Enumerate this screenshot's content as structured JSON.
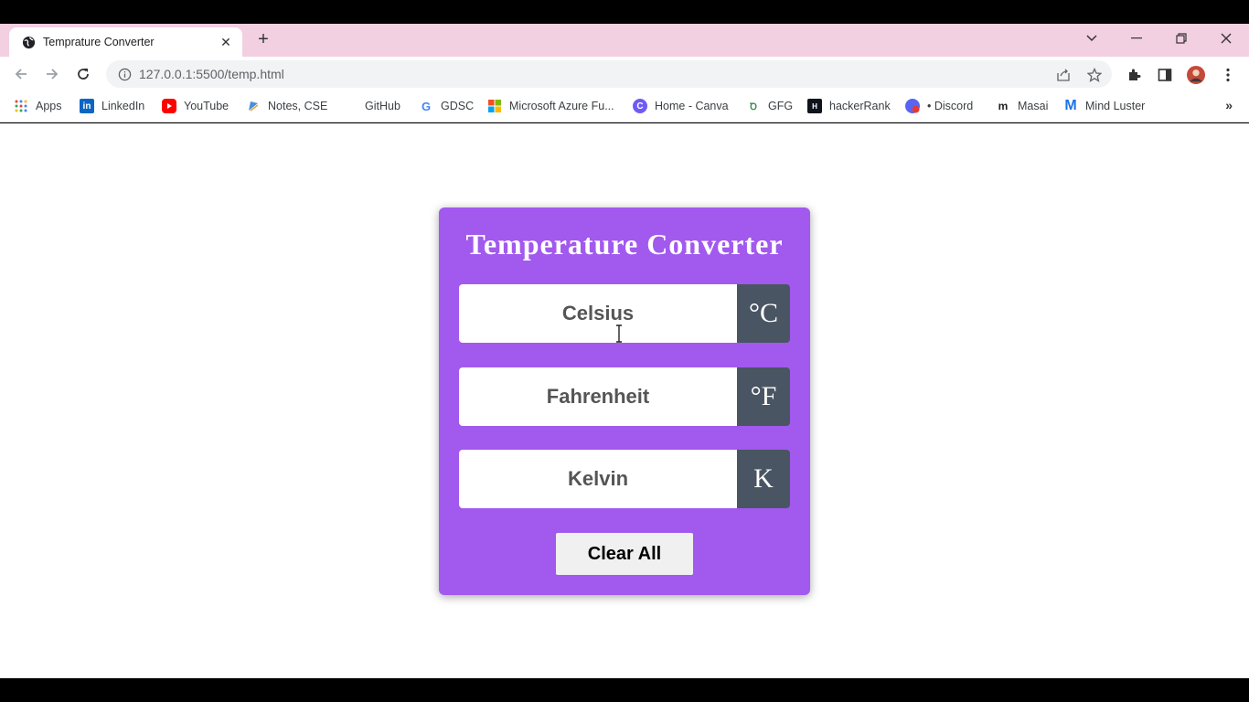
{
  "browser": {
    "tab": {
      "title": "Temprature Converter",
      "close": "✕"
    },
    "new_tab": "+",
    "window_controls": {
      "menu": "⌄",
      "minimize": "—",
      "restore": "❐",
      "close": "✕"
    },
    "url": "127.0.0.1:5500/temp.html",
    "bookmarks": [
      {
        "label": "Apps",
        "icon": "apps-grid-icon"
      },
      {
        "label": "LinkedIn",
        "icon": "linkedin-icon"
      },
      {
        "label": "YouTube",
        "icon": "youtube-icon"
      },
      {
        "label": "Notes, CSE",
        "icon": "notes-icon"
      },
      {
        "label": "GitHub",
        "icon": "github-icon"
      },
      {
        "label": "GDSC",
        "icon": "google-icon"
      },
      {
        "label": "Microsoft Azure Fu...",
        "icon": "microsoft-icon"
      },
      {
        "label": "Home - Canva",
        "icon": "canva-icon"
      },
      {
        "label": "GFG",
        "icon": "gfg-icon"
      },
      {
        "label": "hackerRank",
        "icon": "hackerrank-icon"
      },
      {
        "label": "• Discord",
        "icon": "discord-icon"
      },
      {
        "label": "Masai",
        "icon": "masai-icon"
      },
      {
        "label": "Mind Luster",
        "icon": "mindluster-icon"
      }
    ],
    "bookmarks_more": "»"
  },
  "converter": {
    "title": "Temperature Converter",
    "celsius": {
      "placeholder": "Celsius",
      "unit": "°C"
    },
    "fahrenheit": {
      "placeholder": "Fahrenheit",
      "unit": "°F"
    },
    "kelvin": {
      "placeholder": "Kelvin",
      "unit": "K"
    },
    "clear_label": "Clear All"
  },
  "colors": {
    "card_bg": "#a259ee",
    "unit_bg": "#4a5563",
    "tabstrip_bg": "#f2cfe1"
  }
}
